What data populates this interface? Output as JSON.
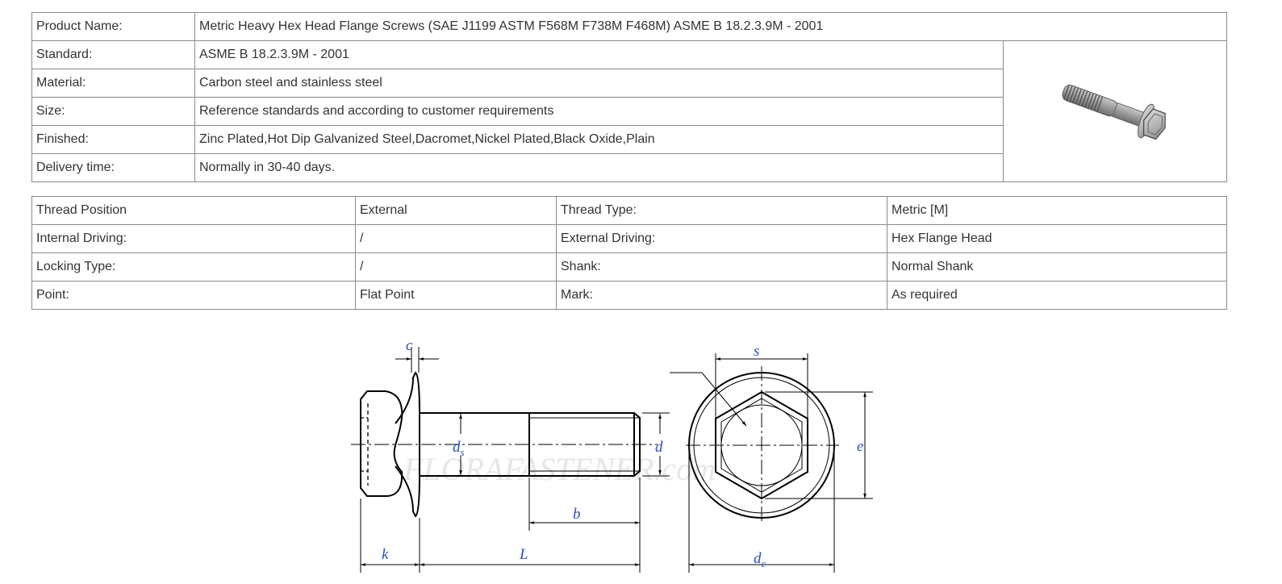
{
  "spec_table": {
    "product_name": {
      "label": "Product Name:",
      "value": "Metric Heavy Hex Head Flange Screws (SAE J1199 ASTM F568M F738M F468M) ASME B 18.2.3.9M - 2001"
    },
    "rows": [
      {
        "label": "Standard:",
        "value": "ASME B 18.2.3.9M - 2001"
      },
      {
        "label": "Material:",
        "value": "Carbon steel and stainless steel"
      },
      {
        "label": "Size:",
        "value": "Reference standards and according to customer requirements"
      },
      {
        "label": "Finished:",
        "value": "Zinc Plated,Hot Dip Galvanized Steel,Dacromet,Nickel Plated,Black Oxide,Plain"
      },
      {
        "label": "Delivery time:",
        "value": "Normally in 30-40 days."
      }
    ]
  },
  "attributes_table": {
    "rows": [
      {
        "l1": "Thread Position",
        "v1": "External",
        "l2": "Thread Type:",
        "v2": "Metric [M]"
      },
      {
        "l1": "Internal Driving:",
        "v1": "/",
        "l2": "External Driving:",
        "v2": "Hex Flange Head"
      },
      {
        "l1": "Locking Type:",
        "v1": "/",
        "l2": "Shank:",
        "v2": "Normal Shank"
      },
      {
        "l1": "Point:",
        "v1": "Flat Point",
        "l2": "Mark:",
        "v2": "As required"
      }
    ]
  },
  "drawing": {
    "dims": {
      "c": "c",
      "ds": "d",
      "ds_sub": "s",
      "d": "d",
      "b": "b",
      "k": "k",
      "L": "L",
      "s": "s",
      "e": "e",
      "dc": "d",
      "dc_sub": "c"
    },
    "watermark": "FLORAFASTENER.com"
  },
  "colors": {
    "border": "#8a8a8a",
    "dimension_text": "#2b4fb5",
    "text": "#333333"
  }
}
